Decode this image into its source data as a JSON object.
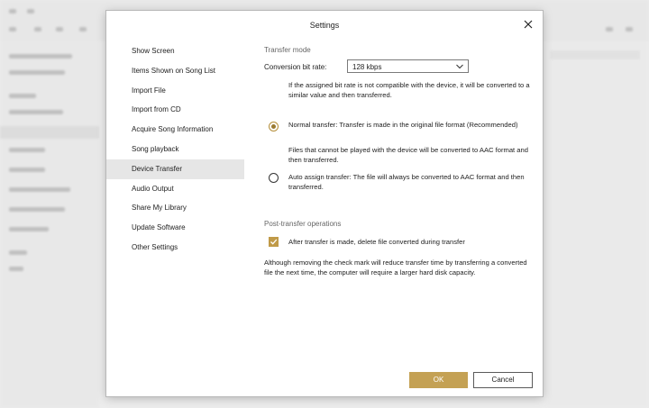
{
  "dialog": {
    "title": "Settings",
    "close_icon": "close-icon"
  },
  "nav": {
    "items": [
      {
        "label": "Show Screen",
        "selected": false
      },
      {
        "label": "Items Shown on Song List",
        "selected": false
      },
      {
        "label": "Import File",
        "selected": false
      },
      {
        "label": "Import from CD",
        "selected": false
      },
      {
        "label": "Acquire Song Information",
        "selected": false
      },
      {
        "label": "Song playback",
        "selected": false
      },
      {
        "label": "Device Transfer",
        "selected": true
      },
      {
        "label": "Audio Output",
        "selected": false
      },
      {
        "label": "Share My Library",
        "selected": false
      },
      {
        "label": "Update Software",
        "selected": false
      },
      {
        "label": "Other Settings",
        "selected": false
      }
    ]
  },
  "transfer_mode": {
    "heading": "Transfer mode",
    "bitrate_label": "Conversion bit rate:",
    "bitrate_value": "128 kbps",
    "bitrate_note": "If the assigned bit rate is not compatible with the device, it will be converted to a similar value and then transferred.",
    "normal": {
      "label": "Normal transfer: Transfer is made in the original file format (Recommended)",
      "note": "Files that cannot be played with the device will be converted to AAC format and then transferred.",
      "checked": true
    },
    "auto": {
      "label": "Auto assign transfer: The file will always be converted to AAC format and then transferred.",
      "checked": false
    }
  },
  "post_transfer": {
    "heading": "Post-transfer operations",
    "delete_label": "After transfer is made, delete file converted during transfer",
    "delete_checked": true,
    "note": "Although removing the check mark will reduce transfer time by transferring a converted file the next time, the computer will require a larger hard disk capacity."
  },
  "buttons": {
    "ok": "OK",
    "cancel": "Cancel"
  },
  "colors": {
    "accent": "#c4a154",
    "selected_nav": "#e6e6e6"
  }
}
